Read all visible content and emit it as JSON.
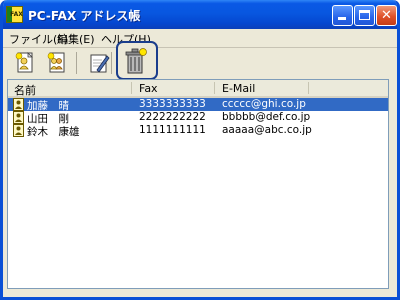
{
  "window": {
    "title": "PC-FAX アドレス帳",
    "icon_label": "FAX"
  },
  "menu": {
    "items": [
      {
        "label": "ファイル(F)"
      },
      {
        "label": "編集(E)"
      },
      {
        "label": "ヘルプ(H)"
      }
    ]
  },
  "toolbar": {
    "buttons": [
      {
        "icon": "new-member-icon"
      },
      {
        "icon": "new-group-icon"
      },
      {
        "icon": "edit-icon"
      },
      {
        "icon": "delete-icon",
        "highlighted": true
      }
    ]
  },
  "list": {
    "columns": [
      "名前",
      "Fax",
      "E-Mail"
    ],
    "rows": [
      {
        "name": "加藤　晴",
        "fax": "3333333333",
        "email": "ccccc@ghi.co.jp",
        "selected": true
      },
      {
        "name": "山田　剛",
        "fax": "2222222222",
        "email": "bbbbb@def.co.jp",
        "selected": false
      },
      {
        "name": "鈴木　康雄",
        "fax": "1111111111",
        "email": "aaaaa@abc.co.jp",
        "selected": false
      }
    ]
  },
  "colors": {
    "titlebar": "#0a58e5",
    "selection": "#316ac5",
    "highlight_border": "#1a3d8c"
  }
}
